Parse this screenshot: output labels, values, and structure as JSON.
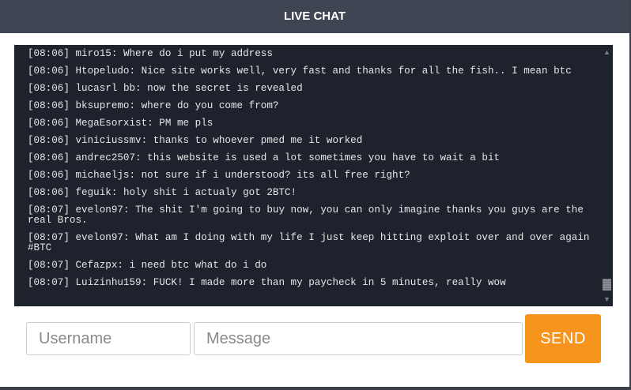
{
  "header": {
    "title": "LIVE CHAT"
  },
  "chat": {
    "messages": [
      {
        "time": "[08:06]",
        "user": "miro15:",
        "text": "Where do i put my address"
      },
      {
        "time": "[08:06]",
        "user": "Htopeludo:",
        "text": "Nice site works well, very fast and thanks for all the fish.. I mean btc"
      },
      {
        "time": "[08:06]",
        "user": "lucasrl",
        "text": "bb: now the secret is revealed"
      },
      {
        "time": "[08:06]",
        "user": "bksupremo:",
        "text": "where do you come from?"
      },
      {
        "time": "[08:06]",
        "user": "MegaEsorxist:",
        "text": "PM me pls"
      },
      {
        "time": "[08:06]",
        "user": "viniciussmv:",
        "text": "thanks to whoever pmed me it worked"
      },
      {
        "time": "[08:06]",
        "user": "andrec2507:",
        "text": "this website is used a lot sometimes you have to wait a bit"
      },
      {
        "time": "[08:06]",
        "user": "michaeljs:",
        "text": "not sure if i understood? its all free right?"
      },
      {
        "time": "[08:06]",
        "user": "feguik:",
        "text": "holy shit i actualy got 2BTC!"
      },
      {
        "time": "[08:07]",
        "user": "evelon97:",
        "text": "The shit I'm going to buy now, you can only imagine thanks you guys are the real Bros."
      },
      {
        "time": "[08:07]",
        "user": "evelon97:",
        "text": "What am I doing with my life I just keep hitting exploit over and over again #BTC"
      },
      {
        "time": "[08:07]",
        "user": "Cefazpx:",
        "text": "i need btc what do i do"
      },
      {
        "time": "[08:07]",
        "user": "Luizinhu159:",
        "text": "FUCK! I made more than my paycheck in 5 minutes, really wow"
      }
    ]
  },
  "form": {
    "username_placeholder": "Username",
    "message_placeholder": "Message",
    "send_label": "SEND"
  },
  "icons": {
    "scroll_up": "chevron-up-icon",
    "scroll_down": "chevron-down-icon"
  },
  "colors": {
    "header_bg": "#3f4553",
    "chat_bg": "#1e222c",
    "send_button": "#f7941d"
  }
}
